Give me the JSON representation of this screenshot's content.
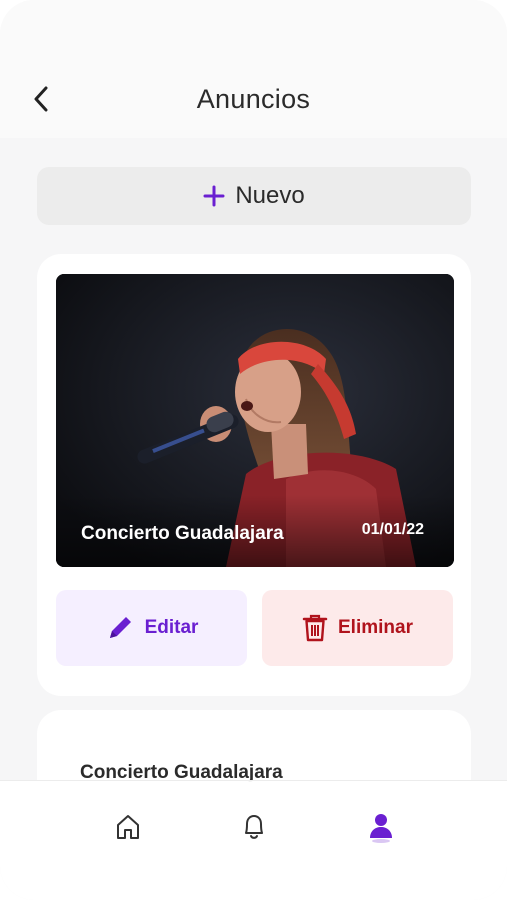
{
  "header": {
    "title": "Anuncios",
    "back_icon": "chevron-left-icon"
  },
  "new_button": {
    "label": "Nuevo",
    "icon": "plus-icon",
    "accent": "#6a1fd1"
  },
  "announcements": [
    {
      "title": "Concierto Guadalajara",
      "date": "01/01/22",
      "image": "singer-with-microphone-photo",
      "edit_label": "Editar",
      "delete_label": "Eliminar"
    },
    {
      "title": "Concierto Guadalajara"
    }
  ],
  "bottom_nav": {
    "items": [
      {
        "icon": "home-icon",
        "active": false
      },
      {
        "icon": "bell-icon",
        "active": false
      },
      {
        "icon": "user-icon",
        "active": true
      }
    ],
    "active_color": "#6a1fd1"
  },
  "colors": {
    "edit": "#6a1fd1",
    "delete": "#b0131c"
  }
}
